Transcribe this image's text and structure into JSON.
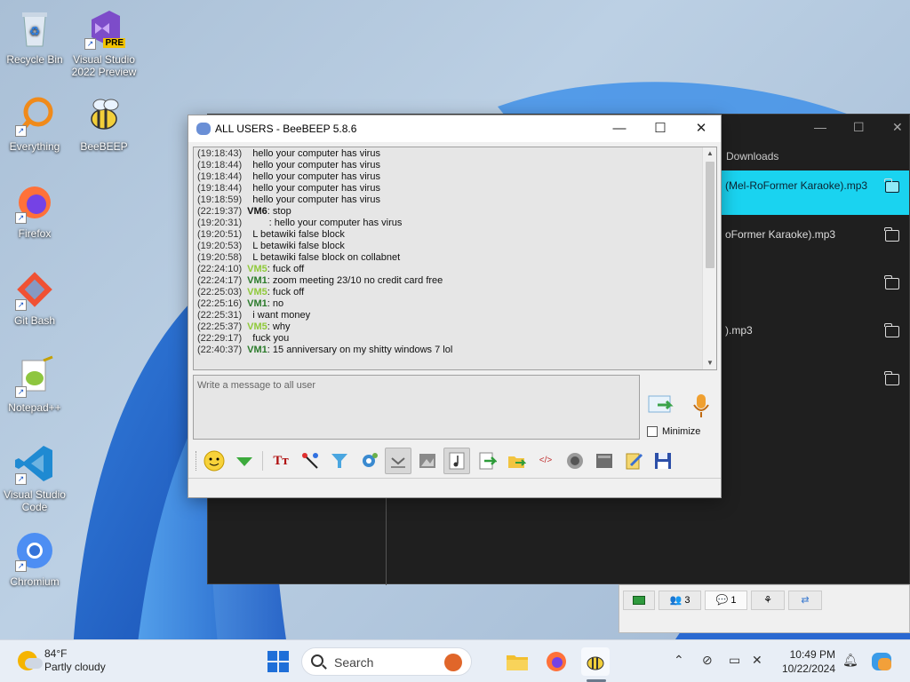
{
  "desktop": {
    "icons": [
      {
        "label": "Recycle Bin"
      },
      {
        "label": "Visual Studio 2022 Preview",
        "badge": "PRE"
      },
      {
        "label": "Everything"
      },
      {
        "label": "BeeBEEP"
      },
      {
        "label": "Firefox"
      },
      {
        "label": "Git Bash"
      },
      {
        "label": "Notepad++"
      },
      {
        "label": "Visual Studio Code"
      },
      {
        "label": "Chromium"
      }
    ]
  },
  "bg_window": {
    "nav_label": "Downloads",
    "rows": [
      {
        "text": "(Mel-RoFormer Karaoke).mp3",
        "selected": true
      },
      {
        "text": "oFormer Karaoke).mp3"
      },
      {
        "text": ""
      },
      {
        "text": ").mp3"
      },
      {
        "text": ""
      }
    ]
  },
  "beebeep": {
    "title": "ALL USERS - BeeBEEP 5.8.6",
    "messages": [
      {
        "time": "(19:18:43)",
        "user": "",
        "text": "hello your computer has virus"
      },
      {
        "time": "(19:18:44)",
        "user": "",
        "text": "hello your computer has virus"
      },
      {
        "time": "(19:18:44)",
        "user": "",
        "text": "hello your computer has virus"
      },
      {
        "time": "(19:18:44)",
        "user": "",
        "text": "hello your computer has virus"
      },
      {
        "time": "(19:18:59)",
        "user": "",
        "text": "hello your computer has virus"
      },
      {
        "time": "(22:19:37)",
        "user": "VM6",
        "text": "stop"
      },
      {
        "time": "(19:20:31)",
        "user": "",
        "text": ": hello your computer has virus"
      },
      {
        "time": "(19:20:51)",
        "user": "",
        "text": "L betawiki false block"
      },
      {
        "time": "(19:20:53)",
        "user": "",
        "text": "L betawiki false block"
      },
      {
        "time": "(19:20:58)",
        "user": "",
        "text": "L betawiki false block on collabnet"
      },
      {
        "time": "(22:24:10)",
        "user": "VM5",
        "text": "fuck off"
      },
      {
        "time": "(22:24:17)",
        "user": "VM1",
        "text": "zoom meeting 23/10 no credit card free"
      },
      {
        "time": "(22:25:03)",
        "user": "VM5",
        "text": "fuck off"
      },
      {
        "time": "(22:25:16)",
        "user": "VM1",
        "text": "no"
      },
      {
        "time": "(22:25:31)",
        "user": "",
        "text": "i want money"
      },
      {
        "time": "(22:25:37)",
        "user": "VM5",
        "text": "why"
      },
      {
        "time": "(22:29:17)",
        "user": "",
        "text": "fuck you"
      },
      {
        "time": "(22:40:37)",
        "user": "VM1",
        "text": "15 anniversary on my shitty windows 7 lol"
      }
    ],
    "input_placeholder": "Write a message to all user",
    "minimize_label": "Minimize",
    "toolbar_icons": [
      "emoticon-icon",
      "download-arrow-icon",
      "font-icon",
      "color-picker-icon",
      "filter-icon",
      "settings-icon",
      "scroll-lock-icon",
      "image-icon",
      "music-icon",
      "export-icon",
      "send-file-icon",
      "html-icon",
      "record-icon",
      "screenshot-icon",
      "edit-icon",
      "save-icon"
    ],
    "status_panel": {
      "users_count": "3",
      "chats_count": "1"
    }
  },
  "taskbar": {
    "temperature": "84°F",
    "condition": "Partly cloudy",
    "search_label": "Search",
    "time": "10:49 PM",
    "date": "10/22/2024"
  }
}
